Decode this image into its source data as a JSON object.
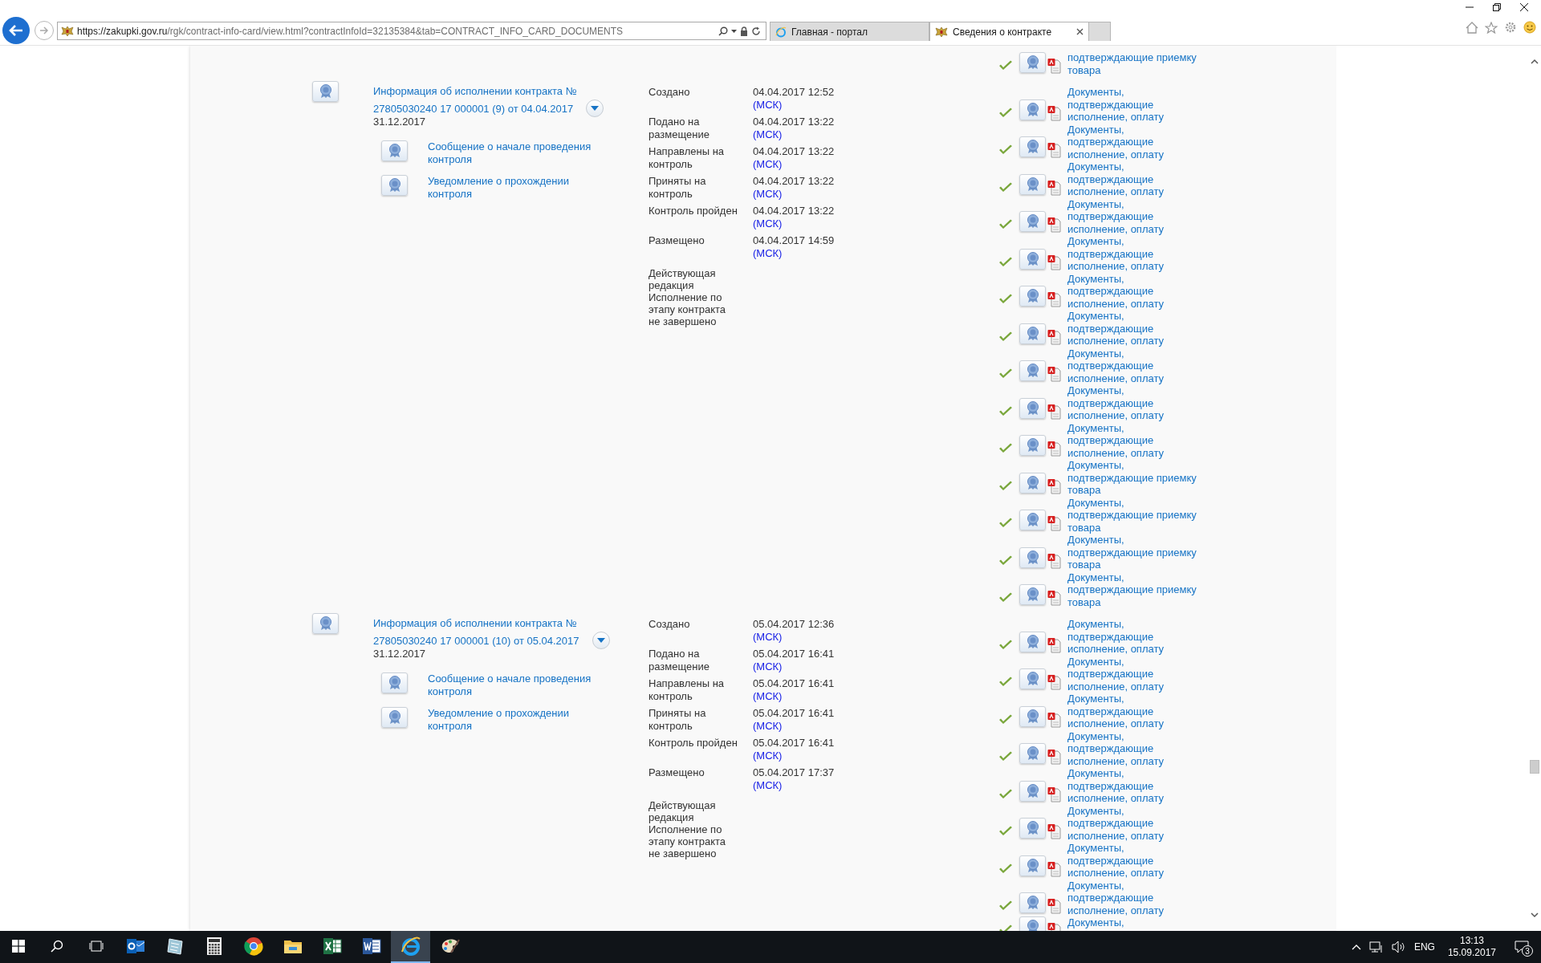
{
  "browser": {
    "url_host": "https://zakupki.gov.ru",
    "url_path": "/rgk/contract-info-card/view.html?contractInfoId=32135384&tab=CONTRACT_INFO_CARD_DOCUMENTS",
    "tabs": [
      {
        "label": "Главная - портал",
        "selected": false
      },
      {
        "label": "Сведения о контракте",
        "selected": true
      }
    ]
  },
  "rows": [
    {
      "documents": [
        {
          "text": "подтверждающие приемку товара",
          "verified": true
        }
      ]
    },
    {
      "title": "Информация об исполнении контракта №",
      "number": "27805030240 17 000001 (9) от 04.04.2017",
      "date": "31.12.2017",
      "links": [
        "Сообщение о начале проведения контроля",
        "Уведомление о прохождении контроля"
      ],
      "statuses": [
        {
          "label": "Создано",
          "value": "04.04.2017 12:52",
          "zone": "(МСК)"
        },
        {
          "label": "Подано на размещение",
          "value": "04.04.2017 13:22",
          "zone": "(МСК)"
        },
        {
          "label": "Направлены на контроль",
          "value": "04.04.2017 13:22",
          "zone": "(МСК)"
        },
        {
          "label": "Приняты на контроль",
          "value": "04.04.2017 13:22",
          "zone": "(МСК)"
        },
        {
          "label": "Контроль пройден",
          "value": "04.04.2017 13:22",
          "zone": "(МСК)"
        },
        {
          "label": "Размещено",
          "value": "04.04.2017 14:59",
          "zone": "(МСК)"
        }
      ],
      "notes": [
        "Действующая редакция",
        "Исполнение по этапу контракта не завершено"
      ],
      "documents": [
        {
          "text": "Документы, подтверждающие исполнение, оплату",
          "verified": true
        },
        {
          "text": "Документы, подтверждающие исполнение, оплату",
          "verified": true
        },
        {
          "text": "Документы, подтверждающие исполнение, оплату",
          "verified": true
        },
        {
          "text": "Документы, подтверждающие исполнение, оплату",
          "verified": true
        },
        {
          "text": "Документы, подтверждающие исполнение, оплату",
          "verified": true
        },
        {
          "text": "Документы, подтверждающие исполнение, оплату",
          "verified": true
        },
        {
          "text": "Документы, подтверждающие исполнение, оплату",
          "verified": true
        },
        {
          "text": "Документы, подтверждающие исполнение, оплату",
          "verified": true
        },
        {
          "text": "Документы, подтверждающие исполнение, оплату",
          "verified": true
        },
        {
          "text": "Документы, подтверждающие исполнение, оплату",
          "verified": true
        },
        {
          "text": "Документы, подтверждающие приемку товара",
          "verified": true
        },
        {
          "text": "Документы, подтверждающие приемку товара",
          "verified": true
        },
        {
          "text": "Документы, подтверждающие приемку товара",
          "verified": true
        },
        {
          "text": "Документы, подтверждающие приемку товара",
          "verified": true
        }
      ]
    },
    {
      "title": "Информация об исполнении контракта №",
      "number": "27805030240 17 000001 (10) от 05.04.2017",
      "date": "31.12.2017",
      "links": [
        "Сообщение о начале проведения контроля",
        "Уведомление о прохождении контроля"
      ],
      "statuses": [
        {
          "label": "Создано",
          "value": "05.04.2017 12:36",
          "zone": "(МСК)"
        },
        {
          "label": "Подано на размещение",
          "value": "05.04.2017 16:41",
          "zone": "(МСК)"
        },
        {
          "label": "Направлены на контроль",
          "value": "05.04.2017 16:41",
          "zone": "(МСК)"
        },
        {
          "label": "Приняты на контроль",
          "value": "05.04.2017 16:41",
          "zone": "(МСК)"
        },
        {
          "label": "Контроль пройден",
          "value": "05.04.2017 16:41",
          "zone": "(МСК)"
        },
        {
          "label": "Размещено",
          "value": "05.04.2017 17:37",
          "zone": "(МСК)"
        }
      ],
      "notes": [
        "Действующая редакция",
        "Исполнение по этапу контракта не завершено"
      ],
      "documents": [
        {
          "text": "Документы, подтверждающие исполнение, оплату",
          "verified": true
        },
        {
          "text": "Документы, подтверждающие исполнение, оплату",
          "verified": true
        },
        {
          "text": "Документы, подтверждающие исполнение, оплату",
          "verified": true
        },
        {
          "text": "Документы, подтверждающие исполнение, оплату",
          "verified": true
        },
        {
          "text": "Документы, подтверждающие исполнение, оплату",
          "verified": true
        },
        {
          "text": "Документы, подтверждающие исполнение, оплату",
          "verified": true
        },
        {
          "text": "Документы, подтверждающие исполнение, оплату",
          "verified": true
        },
        {
          "text": "Документы, подтверждающие исполнение, оплату",
          "verified": true
        },
        {
          "text": "Документы,",
          "verified": true
        }
      ]
    }
  ],
  "taskbar": {
    "apps": [
      {
        "kind": "mail",
        "active": false
      },
      {
        "kind": "notes",
        "active": false
      },
      {
        "kind": "calculator",
        "active": false
      },
      {
        "kind": "chrome",
        "active": false
      },
      {
        "kind": "folder",
        "active": false
      },
      {
        "kind": "spreadsheet",
        "active": false
      },
      {
        "kind": "wordprocessor",
        "active": false
      },
      {
        "kind": "web",
        "active": true
      },
      {
        "kind": "paint",
        "active": false
      }
    ],
    "language": "ENG",
    "time": "13:13",
    "date": "15.09.2017",
    "notifications": "3"
  }
}
